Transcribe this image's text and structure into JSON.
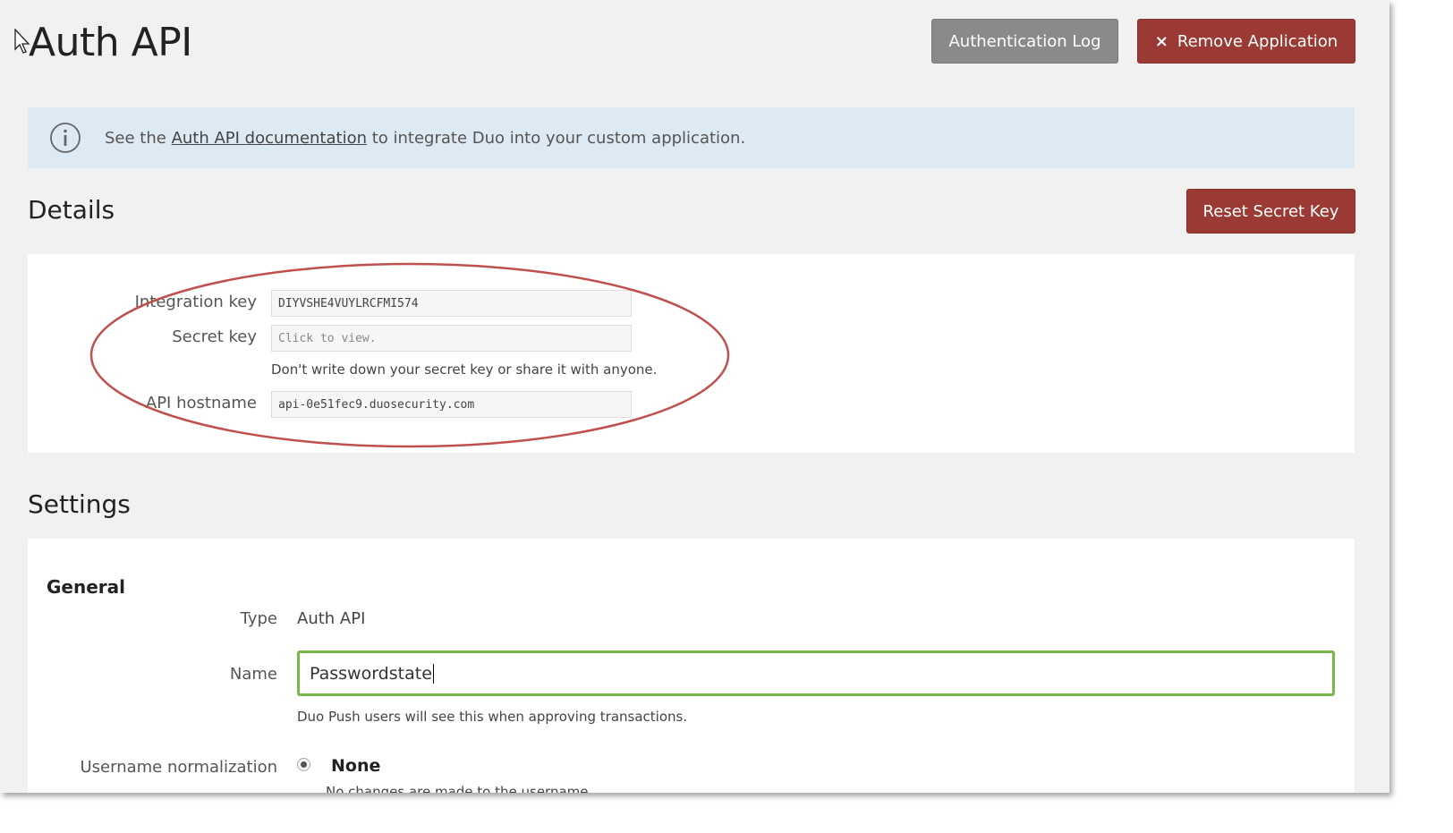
{
  "page": {
    "title": "Auth API"
  },
  "actions": {
    "auth_log_label": "Authentication Log",
    "remove_label": "Remove Application",
    "remove_icon": "×"
  },
  "banner": {
    "prefix": "See the ",
    "link": "Auth API documentation",
    "suffix": " to integrate Duo into your custom application."
  },
  "details": {
    "heading": "Details",
    "reset_label": "Reset Secret Key",
    "integration_key_label": "Integration key",
    "integration_key_value": "DIYVSHE4VUYLRCFMI574",
    "secret_key_label": "Secret key",
    "secret_key_placeholder": "Click to view.",
    "secret_key_help": "Don't write down your secret key or share it with anyone.",
    "api_hostname_label": "API hostname",
    "api_hostname_value": "api-0e51fec9.duosecurity.com"
  },
  "settings": {
    "heading": "Settings",
    "general": {
      "heading": "General",
      "type_label": "Type",
      "type_value": "Auth API",
      "name_label": "Name",
      "name_value": "Passwordstate",
      "name_help": "Duo Push users will see this when approving transactions.",
      "username_norm_label": "Username normalization",
      "username_norm_option": "None",
      "username_norm_help": "No changes are made to the username."
    }
  },
  "colors": {
    "background": "#f1f1f1",
    "danger": "#9b3a34",
    "neutral_button": "#8a8a8a",
    "info_banner": "#dde9f3",
    "focus_border": "#7ab648",
    "annotation": "#c0504d"
  }
}
